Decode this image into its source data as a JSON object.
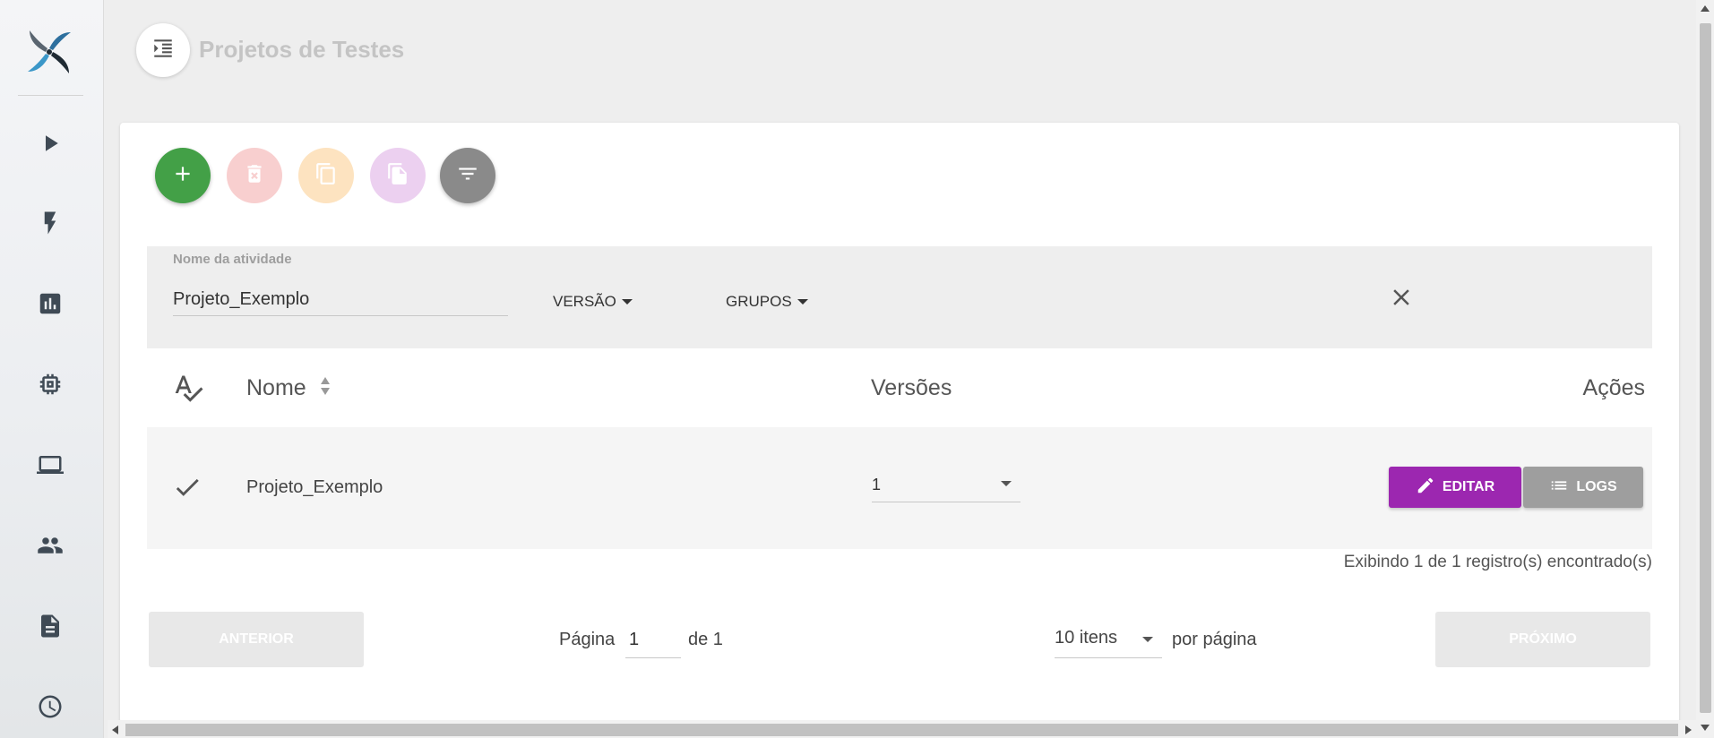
{
  "header": {
    "title": "Projetos de Testes",
    "menu_icon": "indent-menu-icon"
  },
  "sidebar": {
    "items": [
      {
        "name": "play-icon"
      },
      {
        "name": "lightning-icon"
      },
      {
        "name": "bar-chart-icon"
      },
      {
        "name": "chip-icon"
      },
      {
        "name": "laptop-icon"
      },
      {
        "name": "users-icon"
      },
      {
        "name": "document-icon"
      },
      {
        "name": "clock-icon"
      }
    ]
  },
  "actions": {
    "add_icon": "plus-icon",
    "delete_icon": "trash-icon",
    "copy_icon": "copy-icon",
    "paste_icon": "paste-icon",
    "filter_icon": "filter-icon",
    "colors": {
      "add": "#43a047",
      "delete": "#f8cfcf",
      "copy": "#fde3c0",
      "paste": "#ecd0f0",
      "filter": "#8a8a8a"
    }
  },
  "filters": {
    "name_label": "Nome da atividade",
    "name_value": "Projeto_Exemplo",
    "version_label": "VERSÃO",
    "groups_label": "GRUPOS"
  },
  "table": {
    "columns": {
      "name": "Nome",
      "versions": "Versões",
      "actions": "Ações"
    },
    "rows": [
      {
        "name": "Projeto_Exemplo",
        "version": "1",
        "edit_label": "EDITAR",
        "logs_label": "LOGS"
      }
    ],
    "colors": {
      "edit": "#9c27b0",
      "logs": "#9e9e9e"
    }
  },
  "records_text": "Exibindo 1 de 1 registro(s) encontrado(s)",
  "pagination": {
    "prev_label": "ANTERIOR",
    "next_label": "PRÓXIMO",
    "page_label": "Página",
    "page_value": "1",
    "of_label": "de 1",
    "per_page_value": "10 itens",
    "per_page_label": "por página"
  }
}
